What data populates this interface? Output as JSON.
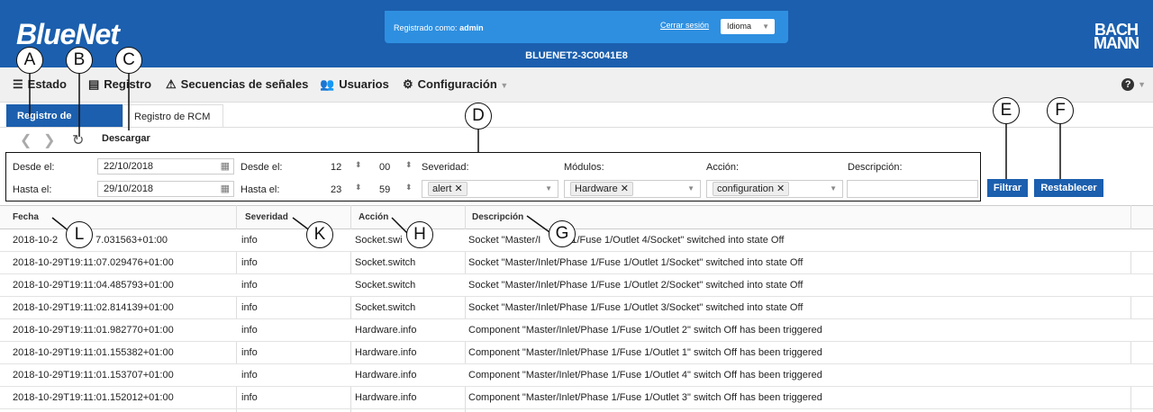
{
  "header": {
    "logo": "BlueNet",
    "login_label": "Registrado como:",
    "login_user": "admin",
    "logout": "Cerrar sesión",
    "language": "Idioma",
    "device": "BLUENET2-3C0041E8",
    "brand_line1": "BACH",
    "brand_line2": "MANN"
  },
  "nav": {
    "items": [
      {
        "label": "Estado",
        "icon": "stack-icon"
      },
      {
        "label": "Registro",
        "icon": "document-icon"
      },
      {
        "label": "Secuencias de señales",
        "icon": "warning-icon"
      },
      {
        "label": "Usuarios",
        "icon": "users-icon"
      },
      {
        "label": "Configuración",
        "icon": "gear-icon"
      }
    ],
    "help": "?"
  },
  "tabs": {
    "events": "Registro de eventos",
    "rcm": "Registro de RCM"
  },
  "toolbar": {
    "prev": "❮",
    "next": "❯",
    "refresh": "↻",
    "download": "Descargar"
  },
  "filters": {
    "from_label": "Desde el:",
    "to_label": "Hasta el:",
    "from_date": "22/10/2018",
    "to_date": "29/10/2018",
    "from_time_label": "Desde el:",
    "to_time_label": "Hasta el:",
    "from_hour": "12",
    "from_min": "00",
    "to_hour": "23",
    "to_min": "59",
    "severity_label": "Severidad:",
    "severity_tag": "alert",
    "modules_label": "Módulos:",
    "modules_tag": "Hardware",
    "action_label": "Acción:",
    "action_tag": "configuration",
    "description_label": "Descripción:",
    "description_value": "",
    "filter_btn": "Filtrar",
    "reset_btn": "Restablecer"
  },
  "table": {
    "headers": [
      "Fecha",
      "Severidad",
      "Acción",
      "Descripción"
    ],
    "rows": [
      {
        "date": "2018-10-2",
        "date_tail": "7.031563+01:00",
        "sev": "info",
        "action": "Socket.swi",
        "desc_head": "Socket \"Master/I",
        "desc": "1/Fuse 1/Outlet 4/Socket\" switched into state Off"
      },
      {
        "date": "2018-10-29T19:11:07.029476+01:00",
        "sev": "info",
        "action": "Socket.switch",
        "desc": "Socket \"Master/Inlet/Phase 1/Fuse 1/Outlet 1/Socket\" switched into state Off"
      },
      {
        "date": "2018-10-29T19:11:04.485793+01:00",
        "sev": "info",
        "action": "Socket.switch",
        "desc": "Socket \"Master/Inlet/Phase 1/Fuse 1/Outlet 2/Socket\" switched into state Off"
      },
      {
        "date": "2018-10-29T19:11:02.814139+01:00",
        "sev": "info",
        "action": "Socket.switch",
        "desc": "Socket \"Master/Inlet/Phase 1/Fuse 1/Outlet 3/Socket\" switched into state Off"
      },
      {
        "date": "2018-10-29T19:11:01.982770+01:00",
        "sev": "info",
        "action": "Hardware.info",
        "desc": "Component \"Master/Inlet/Phase 1/Fuse 1/Outlet 2\" switch Off has been triggered"
      },
      {
        "date": "2018-10-29T19:11:01.155382+01:00",
        "sev": "info",
        "action": "Hardware.info",
        "desc": "Component \"Master/Inlet/Phase 1/Fuse 1/Outlet 1\" switch Off has been triggered"
      },
      {
        "date": "2018-10-29T19:11:01.153707+01:00",
        "sev": "info",
        "action": "Hardware.info",
        "desc": "Component \"Master/Inlet/Phase 1/Fuse 1/Outlet 4\" switch Off has been triggered"
      },
      {
        "date": "2018-10-29T19:11:01.152012+01:00",
        "sev": "info",
        "action": "Hardware.info",
        "desc": "Component \"Master/Inlet/Phase 1/Fuse 1/Outlet 3\" switch Off has been triggered"
      }
    ]
  },
  "callouts": [
    "A",
    "B",
    "C",
    "D",
    "E",
    "F",
    "G",
    "H",
    "K",
    "L"
  ],
  "colors": {
    "primary": "#1b5fae",
    "accent": "#2e8fe0"
  }
}
